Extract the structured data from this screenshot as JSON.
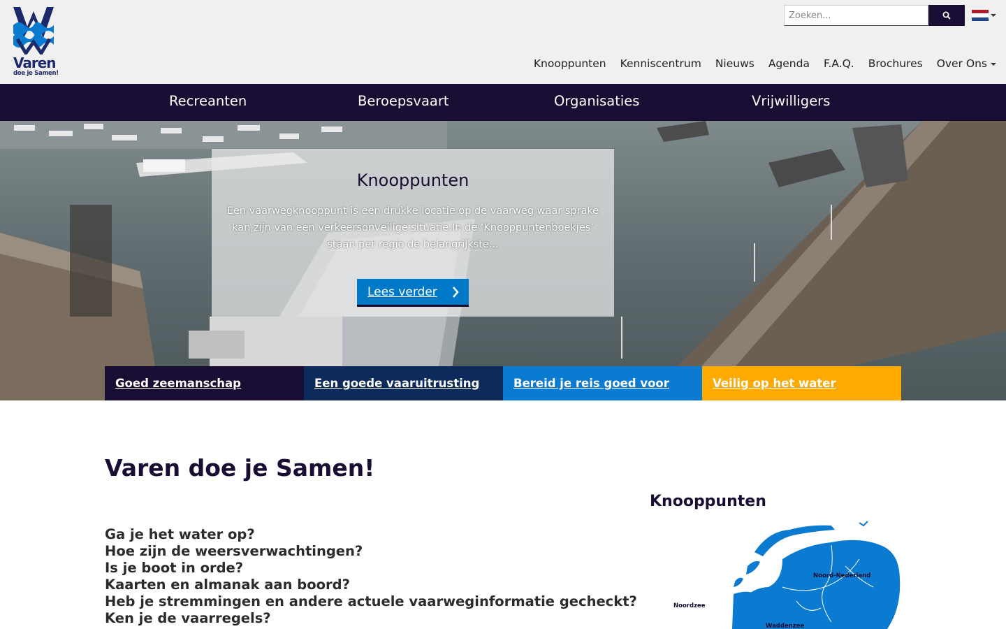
{
  "header": {
    "logo": {
      "word": "Varen",
      "tagline": "doe je Samen!"
    },
    "search": {
      "placeholder": "Zoeken...",
      "value": ""
    },
    "language": {
      "current": "Nederlands",
      "flag_colors": [
        "#ae1c28",
        "#ffffff",
        "#21468b"
      ]
    },
    "top_nav": [
      {
        "label": "Knooppunten"
      },
      {
        "label": "Kenniscentrum"
      },
      {
        "label": "Nieuws"
      },
      {
        "label": "Agenda"
      },
      {
        "label": "F.A.Q."
      },
      {
        "label": "Brochures"
      },
      {
        "label": "Over Ons"
      }
    ]
  },
  "main_nav": [
    {
      "label": "Recreanten"
    },
    {
      "label": "Beroepsvaart"
    },
    {
      "label": "Organisaties"
    },
    {
      "label": "Vrijwilligers"
    }
  ],
  "hero": {
    "title": "Knooppunten",
    "text": "Een vaarwegknooppunt is een drukke locatie op de vaarweg waar sprake kan zijn van een verkeersonveilige situatie.In de ‘Knooppuntenboekjes’ staan per regio de belangrijkste...",
    "button_label": "Lees verder",
    "tiles": [
      {
        "label": "Goed zeemanschap",
        "color": "#1a0d33"
      },
      {
        "label": "Een goede vaaruitrusting",
        "color": "#0d2a5c"
      },
      {
        "label": "Bereid je reis goed voor",
        "color": "#0a7bd0"
      },
      {
        "label": "Veilig op het water",
        "color": "#ffaa00"
      }
    ]
  },
  "content": {
    "title": "Varen doe je Samen!",
    "questions": [
      "Ga je het water op?",
      "Hoe zijn de weersverwachtingen?",
      "Is je boot in orde?",
      "Kaarten en almanak aan boord?",
      "Heb je stremmingen en andere actuele vaarweginformatie gecheckt?",
      "Ken je de vaarregels?"
    ]
  },
  "sidebar": {
    "title": "Knooppunten",
    "map_labels": {
      "region": "Noord-Nederland",
      "sea": "Noordzee",
      "wadden": "Waddenzee"
    }
  },
  "colors": {
    "brand_dark": "#1a0d33",
    "brand_blue": "#0078c8",
    "header_bg": "#f0f0f0"
  }
}
